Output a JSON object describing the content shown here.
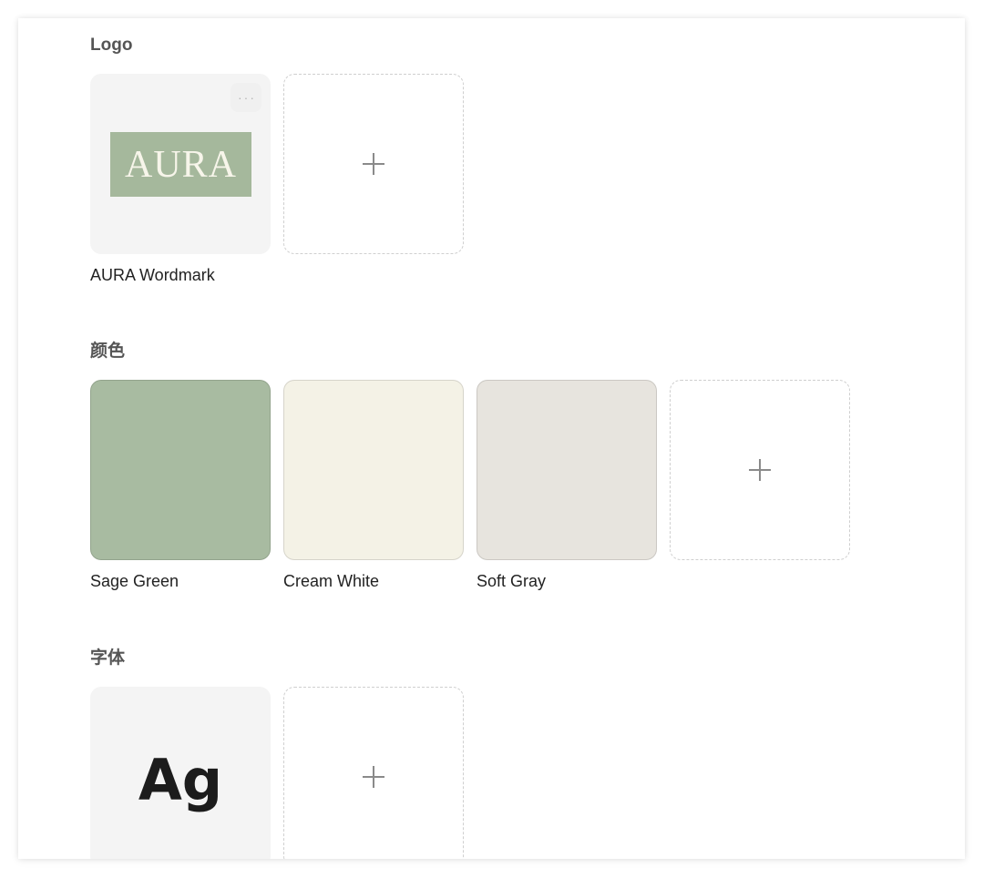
{
  "logo_section": {
    "title": "Logo",
    "items": [
      {
        "label": "AURA Wordmark",
        "mark_text": "AURA",
        "background": "#a5b89c",
        "text_color": "#f7f5ea"
      }
    ],
    "more_label": "···"
  },
  "color_section": {
    "title": "颜色",
    "items": [
      {
        "label": "Sage Green",
        "hex": "#a8bba1"
      },
      {
        "label": "Cream White",
        "hex": "#f4f2e6"
      },
      {
        "label": "Soft Gray",
        "hex": "#e7e4de"
      }
    ]
  },
  "font_section": {
    "title": "字体",
    "items": [
      {
        "sample": "Ag"
      }
    ]
  }
}
